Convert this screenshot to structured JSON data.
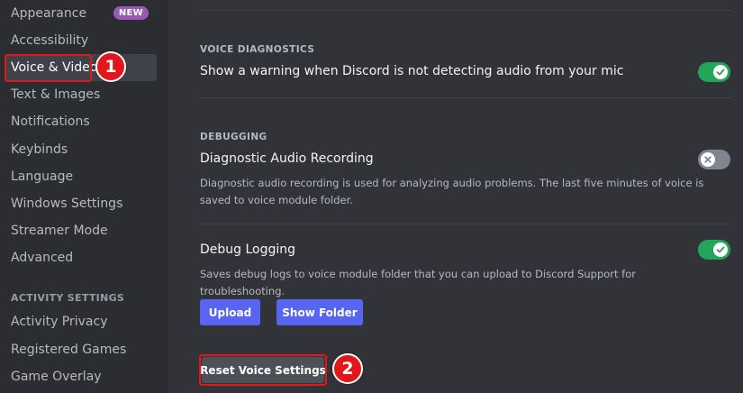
{
  "sidebar": {
    "items": [
      {
        "label": "Appearance",
        "badge": "NEW"
      },
      {
        "label": "Accessibility"
      },
      {
        "label": "Voice & Video",
        "selected": true
      },
      {
        "label": "Text & Images"
      },
      {
        "label": "Notifications"
      },
      {
        "label": "Keybinds"
      },
      {
        "label": "Language"
      },
      {
        "label": "Windows Settings"
      },
      {
        "label": "Streamer Mode"
      },
      {
        "label": "Advanced"
      }
    ],
    "activity_header": "ACTIVITY SETTINGS",
    "activity_items": [
      {
        "label": "Activity Privacy"
      },
      {
        "label": "Registered Games"
      },
      {
        "label": "Game Overlay"
      }
    ]
  },
  "annotations": {
    "step1": "1",
    "step2": "2"
  },
  "voice_diagnostics": {
    "title": "VOICE DIAGNOSTICS",
    "warning_label": "Show a warning when Discord is not detecting audio from your mic",
    "warning_enabled": true
  },
  "debugging": {
    "title": "DEBUGGING",
    "recording_label": "Diagnostic Audio Recording",
    "recording_enabled": false,
    "recording_desc": "Diagnostic audio recording is used for analyzing audio problems. The last five minutes of voice is saved to voice module folder.",
    "logging_label": "Debug Logging",
    "logging_enabled": true,
    "logging_desc": "Saves debug logs to voice module folder that you can upload to Discord Support for troubleshooting.",
    "upload_label": "Upload",
    "show_folder_label": "Show Folder",
    "reset_label": "Reset Voice Settings"
  },
  "colors": {
    "accent": "#5865f2",
    "toggle_on": "#23a55a",
    "annotation": "#e3161b"
  }
}
